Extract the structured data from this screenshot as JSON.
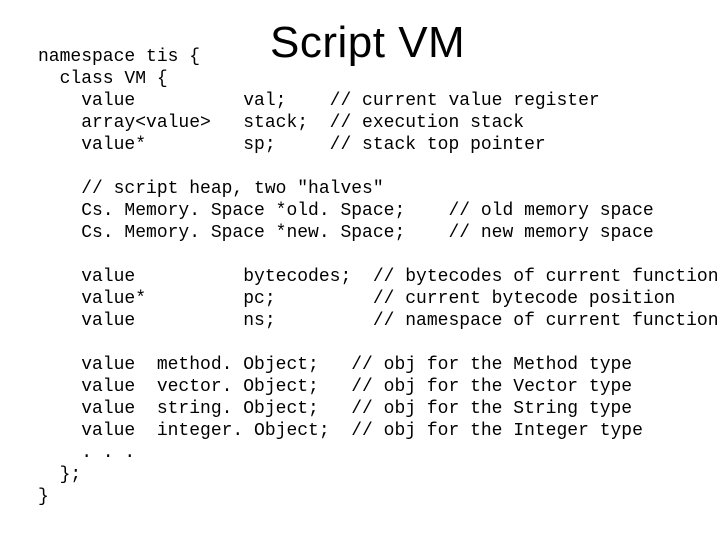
{
  "title": "Script VM",
  "code": {
    "l01": "namespace tis {",
    "l02": "  class VM {",
    "l03": "    value          val;    // current value register",
    "l04": "    array<value>   stack;  // execution stack",
    "l05": "    value*         sp;     // stack top pointer",
    "l06": "",
    "l07": "    // script heap, two \"halves\"",
    "l08": "    Cs. Memory. Space *old. Space;    // old memory space",
    "l09": "    Cs. Memory. Space *new. Space;    // new memory space",
    "l10": "",
    "l11": "    value          bytecodes;  // bytecodes of current function",
    "l12": "    value*         pc;         // current bytecode position",
    "l13": "    value          ns;         // namespace of current function",
    "l14": "",
    "l15": "    value  method. Object;   // obj for the Method type",
    "l16": "    value  vector. Object;   // obj for the Vector type",
    "l17": "    value  string. Object;   // obj for the String type",
    "l18": "    value  integer. Object;  // obj for the Integer type",
    "l19": "    . . .",
    "l20": "  };",
    "l21": "}"
  }
}
